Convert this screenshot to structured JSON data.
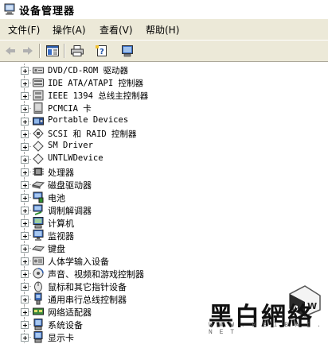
{
  "window": {
    "title": "设备管理器"
  },
  "menu": {
    "items": [
      {
        "label": "文件(F)"
      },
      {
        "label": "操作(A)"
      },
      {
        "label": "查看(V)"
      },
      {
        "label": "帮助(H)"
      }
    ]
  },
  "toolbar": {
    "icons": [
      "back-arrow-icon",
      "forward-arrow-icon",
      "properties-pane-icon",
      "print-icon",
      "help-icon",
      "scan-hardware-icon"
    ]
  },
  "tree": {
    "items": [
      {
        "label": "DVD/CD-ROM 驱动器",
        "icon": "dvd-drive-icon"
      },
      {
        "label": "IDE ATA/ATAPI 控制器",
        "icon": "ide-controller-icon"
      },
      {
        "label": "IEEE 1394 总线主控制器",
        "icon": "ieee1394-icon"
      },
      {
        "label": "PCMCIA 卡",
        "icon": "pcmcia-card-icon"
      },
      {
        "label": "Portable Devices",
        "icon": "portable-device-icon"
      },
      {
        "label": "SCSI 和 RAID 控制器",
        "icon": "scsi-controller-icon"
      },
      {
        "label": "SM Driver",
        "icon": "sm-driver-icon"
      },
      {
        "label": "UNTLWDevice",
        "icon": "unknown-device-icon"
      },
      {
        "label": "处理器",
        "icon": "processor-icon"
      },
      {
        "label": "磁盘驱动器",
        "icon": "disk-drive-icon"
      },
      {
        "label": "电池",
        "icon": "battery-icon"
      },
      {
        "label": "调制解调器",
        "icon": "modem-icon"
      },
      {
        "label": "计算机",
        "icon": "computer-icon"
      },
      {
        "label": "监视器",
        "icon": "monitor-icon"
      },
      {
        "label": "键盘",
        "icon": "keyboard-icon"
      },
      {
        "label": "人体学输入设备",
        "icon": "hid-icon"
      },
      {
        "label": "声音、视频和游戏控制器",
        "icon": "sound-icon"
      },
      {
        "label": "鼠标和其它指针设备",
        "icon": "mouse-icon"
      },
      {
        "label": "通用串行总线控制器",
        "icon": "usb-icon"
      },
      {
        "label": "网络适配器",
        "icon": "network-adapter-icon"
      },
      {
        "label": "系统设备",
        "icon": "system-device-icon"
      },
      {
        "label": "显示卡",
        "icon": "display-adapter-icon"
      }
    ]
  },
  "watermark": {
    "brand": "黑白網絡",
    "url": "W W W . H E I B A I . N E T",
    "logo_text": "BW"
  }
}
